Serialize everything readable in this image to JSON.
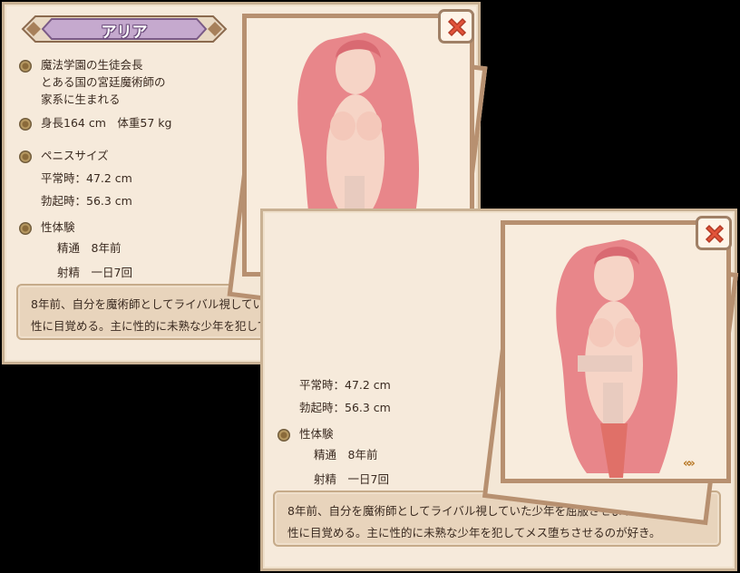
{
  "character": {
    "name": "アリア",
    "profile_lines": [
      "魔法学園の生徒会長",
      "とある国の宮廷魔術師の",
      "家系に生まれる"
    ],
    "height_weight": "身長164 cm　体重57 kg",
    "size_title": "ペニスサイズ",
    "normal_size": "平常時：47.2 cm",
    "erect_size": "勃起時：56.3 cm",
    "experience_title": "性体験",
    "experience_1": "精通　8年前",
    "experience_2": "射精　一日7回",
    "description_line1": "8年前、自分を魔術師としてライバル視していた少年を屈服させようと犯し",
    "description_line2": "性に目覚める。主に性的に未熟な少年を犯してメス堕ちさせるのが好き。"
  },
  "controls": {
    "close_icon": "close-icon",
    "toggle_icon": "double-chevron-icon",
    "toggle_label": "«»"
  },
  "colors": {
    "panel_bg": "#f6eadb",
    "panel_border": "#c9b193",
    "close_red": "#e2533a",
    "accent_orange": "#b97a2a",
    "hair_pink": "#e8868a"
  }
}
